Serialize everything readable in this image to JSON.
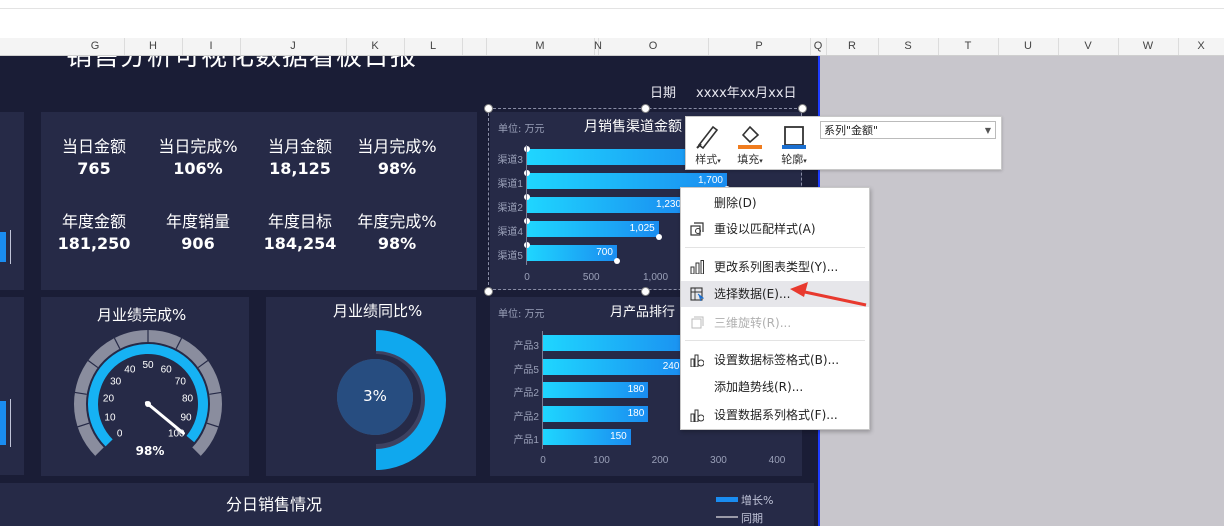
{
  "columns": [
    "G",
    "H",
    "I",
    "J",
    "K",
    "L",
    "M",
    "N",
    "O",
    "P",
    "Q",
    "R",
    "S",
    "T",
    "U",
    "V",
    "W",
    "X"
  ],
  "dashboard": {
    "title": "销售分析可视化数据看板日报",
    "date_label": "日期",
    "date_value": "xxxx年xx月xx日",
    "kpis": [
      {
        "label": "当日金额",
        "value": "765"
      },
      {
        "label": "当日完成%",
        "value": "106%"
      },
      {
        "label": "当月金额",
        "value": "18,125"
      },
      {
        "label": "当月完成%",
        "value": "98%"
      },
      {
        "label": "年度金额",
        "value": "181,250"
      },
      {
        "label": "年度销量",
        "value": "906"
      },
      {
        "label": "年度目标",
        "value": "184,254"
      },
      {
        "label": "年度完成%",
        "value": "98%"
      }
    ],
    "gauge": {
      "title": "月业绩完成%",
      "ticks": [
        "0",
        "10",
        "20",
        "30",
        "40",
        "50",
        "60",
        "70",
        "80",
        "90",
        "100"
      ],
      "value_label": "98%",
      "value": 98,
      "max": 100
    },
    "donut": {
      "title": "月业绩同比%",
      "value_label": "3%",
      "value": 3
    },
    "bottom_title": "分日销售情况",
    "legend": [
      {
        "label": "增长%",
        "color": "#1a8cf0"
      },
      {
        "label": "同期",
        "color": "#9a9aa8"
      }
    ]
  },
  "channel_chart": {
    "unit": "单位: 万元",
    "title": "月销售渠道金额",
    "categories": [
      "渠道3",
      "渠道1",
      "渠道2",
      "渠道4",
      "渠道5"
    ],
    "values": [
      2000,
      1700,
      1230,
      1025,
      700
    ],
    "value_labels": [
      "",
      "1,700",
      "1,230",
      "1,025",
      "700"
    ],
    "x_ticks": [
      "0",
      "500",
      "1,000"
    ]
  },
  "product_chart": {
    "unit": "单位: 万元",
    "title": "月产品排行",
    "categories": [
      "产品3",
      "产品5",
      "产品2",
      "产品2",
      "产品1"
    ],
    "values": [
      260,
      240,
      180,
      180,
      150
    ],
    "value_labels": [
      "",
      "240",
      "180",
      "180",
      "150"
    ],
    "x_ticks": [
      "0",
      "100",
      "200",
      "300",
      "400"
    ]
  },
  "format_toolbar": {
    "style_label": "样式",
    "fill_label": "填充",
    "outline_label": "轮廓",
    "series_select": "系列\"金额\""
  },
  "context_menu": [
    {
      "label": "删除(D)",
      "icon": "none",
      "state": "normal"
    },
    {
      "label": "重设以匹配样式(A)",
      "icon": "reset-style-icon",
      "state": "normal"
    },
    {
      "label": "更改系列图表类型(Y)...",
      "icon": "bar-chart-icon",
      "state": "normal"
    },
    {
      "label": "选择数据(E)...",
      "icon": "select-data-icon",
      "state": "hover"
    },
    {
      "label": "三维旋转(R)...",
      "icon": "rotate-3d-icon",
      "state": "disabled"
    },
    {
      "label": "设置数据标签格式(B)...",
      "icon": "format-label-icon",
      "state": "normal"
    },
    {
      "label": "添加趋势线(R)...",
      "icon": "none",
      "state": "normal"
    },
    {
      "label": "设置数据系列格式(F)...",
      "icon": "format-series-icon",
      "state": "normal"
    }
  ],
  "colors": {
    "accent": "#1a8cf0",
    "dashboard_bg": "#1a1d36",
    "panel_bg": "#262a47",
    "arrow": "#e8392e"
  }
}
